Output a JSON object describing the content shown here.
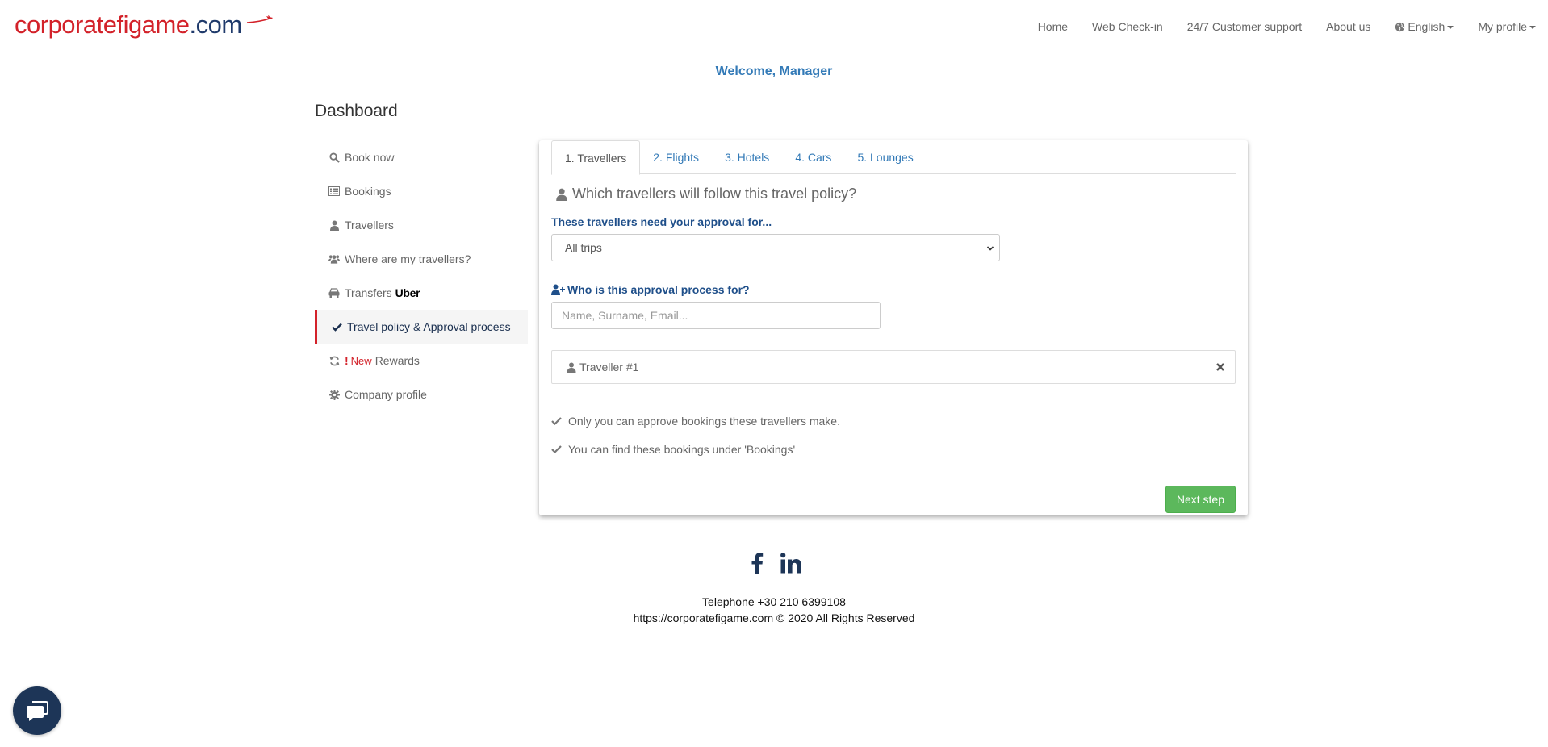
{
  "brand": {
    "logo_part1": "corporate",
    "logo_part2": "figame",
    "logo_part3": ".com"
  },
  "nav": {
    "items": [
      "Home",
      "Web Check-in",
      "24/7 Customer support",
      "About us"
    ],
    "language": "English",
    "profile": "My profile"
  },
  "welcome": "Welcome, Manager",
  "dashboard_title": "Dashboard",
  "sidebar": {
    "items": [
      {
        "label": "Book now",
        "icon": "search-icon"
      },
      {
        "label": "Bookings",
        "icon": "list-icon"
      },
      {
        "label": "Travellers",
        "icon": "user-icon"
      },
      {
        "label": "Where are my travellers?",
        "icon": "users-icon"
      },
      {
        "label": "Transfers",
        "icon": "car-icon",
        "extra": "Uber"
      },
      {
        "label": "Travel policy & Approval process",
        "icon": "check-icon",
        "active": true
      },
      {
        "label": "Rewards",
        "icon": "refresh-icon",
        "badge": "New"
      },
      {
        "label": "Company profile",
        "icon": "gear-icon"
      }
    ]
  },
  "tabs": [
    "1. Travellers",
    "2. Flights",
    "3. Hotels",
    "4. Cars",
    "5. Lounges"
  ],
  "form": {
    "question": "Which travellers will follow this travel policy?",
    "approval_label": "These travellers need your approval for...",
    "approval_value": "All trips",
    "who_label": "Who is this approval process for?",
    "search_placeholder": "Name, Surname, Email...",
    "traveller": "Traveller #1",
    "note1": "Only you can approve bookings these travellers make.",
    "note2": "You can find these bookings under 'Bookings'",
    "next_button": "Next step"
  },
  "footer": {
    "telephone": "Telephone +30 210 6399108",
    "copyright": "https://corporatefigame.com © 2020 All Rights Reserved"
  },
  "colors": {
    "brand_red": "#d3222a",
    "brand_navy": "#1f3a6b",
    "link_blue": "#337ab7",
    "success_green": "#5cb85c"
  }
}
